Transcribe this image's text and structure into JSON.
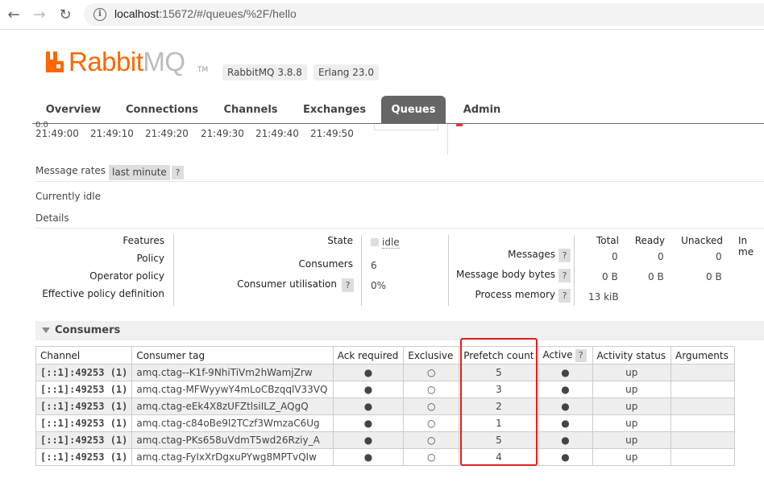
{
  "browser": {
    "url_host": "localhost",
    "url_rest": ":15672/#/queues/%2F/hello"
  },
  "header": {
    "logo_rabbit": "Rabbit",
    "logo_mq": "MQ",
    "logo_tm": "TM",
    "version": "RabbitMQ 3.8.8",
    "erlang": "Erlang 23.0"
  },
  "tabs": [
    {
      "label": "Overview"
    },
    {
      "label": "Connections"
    },
    {
      "label": "Channels"
    },
    {
      "label": "Exchanges"
    },
    {
      "label": "Queues",
      "active": true
    },
    {
      "label": "Admin"
    }
  ],
  "chart": {
    "zero_label": "0.0",
    "times": [
      "21:49:00",
      "21:49:10",
      "21:49:20",
      "21:49:30",
      "21:49:40",
      "21:49:50"
    ]
  },
  "rates": {
    "label": "Message rates",
    "selected": "last minute",
    "help": "?"
  },
  "status": {
    "idle": "Currently idle",
    "details": "Details"
  },
  "details": {
    "features": "Features",
    "policy": "Policy",
    "operator_policy": "Operator policy",
    "effective_policy": "Effective policy definition",
    "state_label": "State",
    "state_value": "idle",
    "consumers_label": "Consumers",
    "consumers_value": "6",
    "utilisation_label": "Consumer utilisation",
    "utilisation_value": "0%",
    "col_total": "Total",
    "col_ready": "Ready",
    "col_unacked": "Unacked",
    "col_inmem": "In me",
    "messages_label": "Messages",
    "messages": [
      "0",
      "0",
      "0"
    ],
    "body_bytes_label": "Message body bytes",
    "body_bytes": [
      "0 B",
      "0 B",
      "0 B"
    ],
    "process_memory_label": "Process memory",
    "process_memory": "13 kiB"
  },
  "consumers": {
    "title": "Consumers",
    "headers": [
      "Channel",
      "Consumer tag",
      "Ack required",
      "Exclusive",
      "Prefetch count",
      "Active",
      "Activity status",
      "Arguments"
    ],
    "rows": [
      {
        "channel": "[::1]:49253 (1)",
        "tag": "amq.ctag--K1f-9NhiTiVm2hWamjZrw",
        "ack": "●",
        "exclusive": "○",
        "prefetch": "5",
        "active": "●",
        "status": "up",
        "args": ""
      },
      {
        "channel": "[::1]:49253 (1)",
        "tag": "amq.ctag-MFWyywY4mLoCBzqqlV33VQ",
        "ack": "●",
        "exclusive": "○",
        "prefetch": "3",
        "active": "●",
        "status": "up",
        "args": ""
      },
      {
        "channel": "[::1]:49253 (1)",
        "tag": "amq.ctag-eEk4X8zUFZtlsiILZ_AQgQ",
        "ack": "●",
        "exclusive": "○",
        "prefetch": "2",
        "active": "●",
        "status": "up",
        "args": ""
      },
      {
        "channel": "[::1]:49253 (1)",
        "tag": "amq.ctag-c84oBe9l2TCzf3WmzaC6Ug",
        "ack": "●",
        "exclusive": "○",
        "prefetch": "1",
        "active": "●",
        "status": "up",
        "args": ""
      },
      {
        "channel": "[::1]:49253 (1)",
        "tag": "amq.ctag-PKs658uVdmT5wd26Rziy_A",
        "ack": "●",
        "exclusive": "○",
        "prefetch": "5",
        "active": "●",
        "status": "up",
        "args": ""
      },
      {
        "channel": "[::1]:49253 (1)",
        "tag": "amq.ctag-FyIxXrDgxuPYwg8MPTvQIw",
        "ack": "●",
        "exclusive": "○",
        "prefetch": "4",
        "active": "●",
        "status": "up",
        "args": ""
      }
    ]
  },
  "colors": {
    "brand": "#ff6600",
    "tab_active": "#666666",
    "highlight": "#e0201b"
  }
}
